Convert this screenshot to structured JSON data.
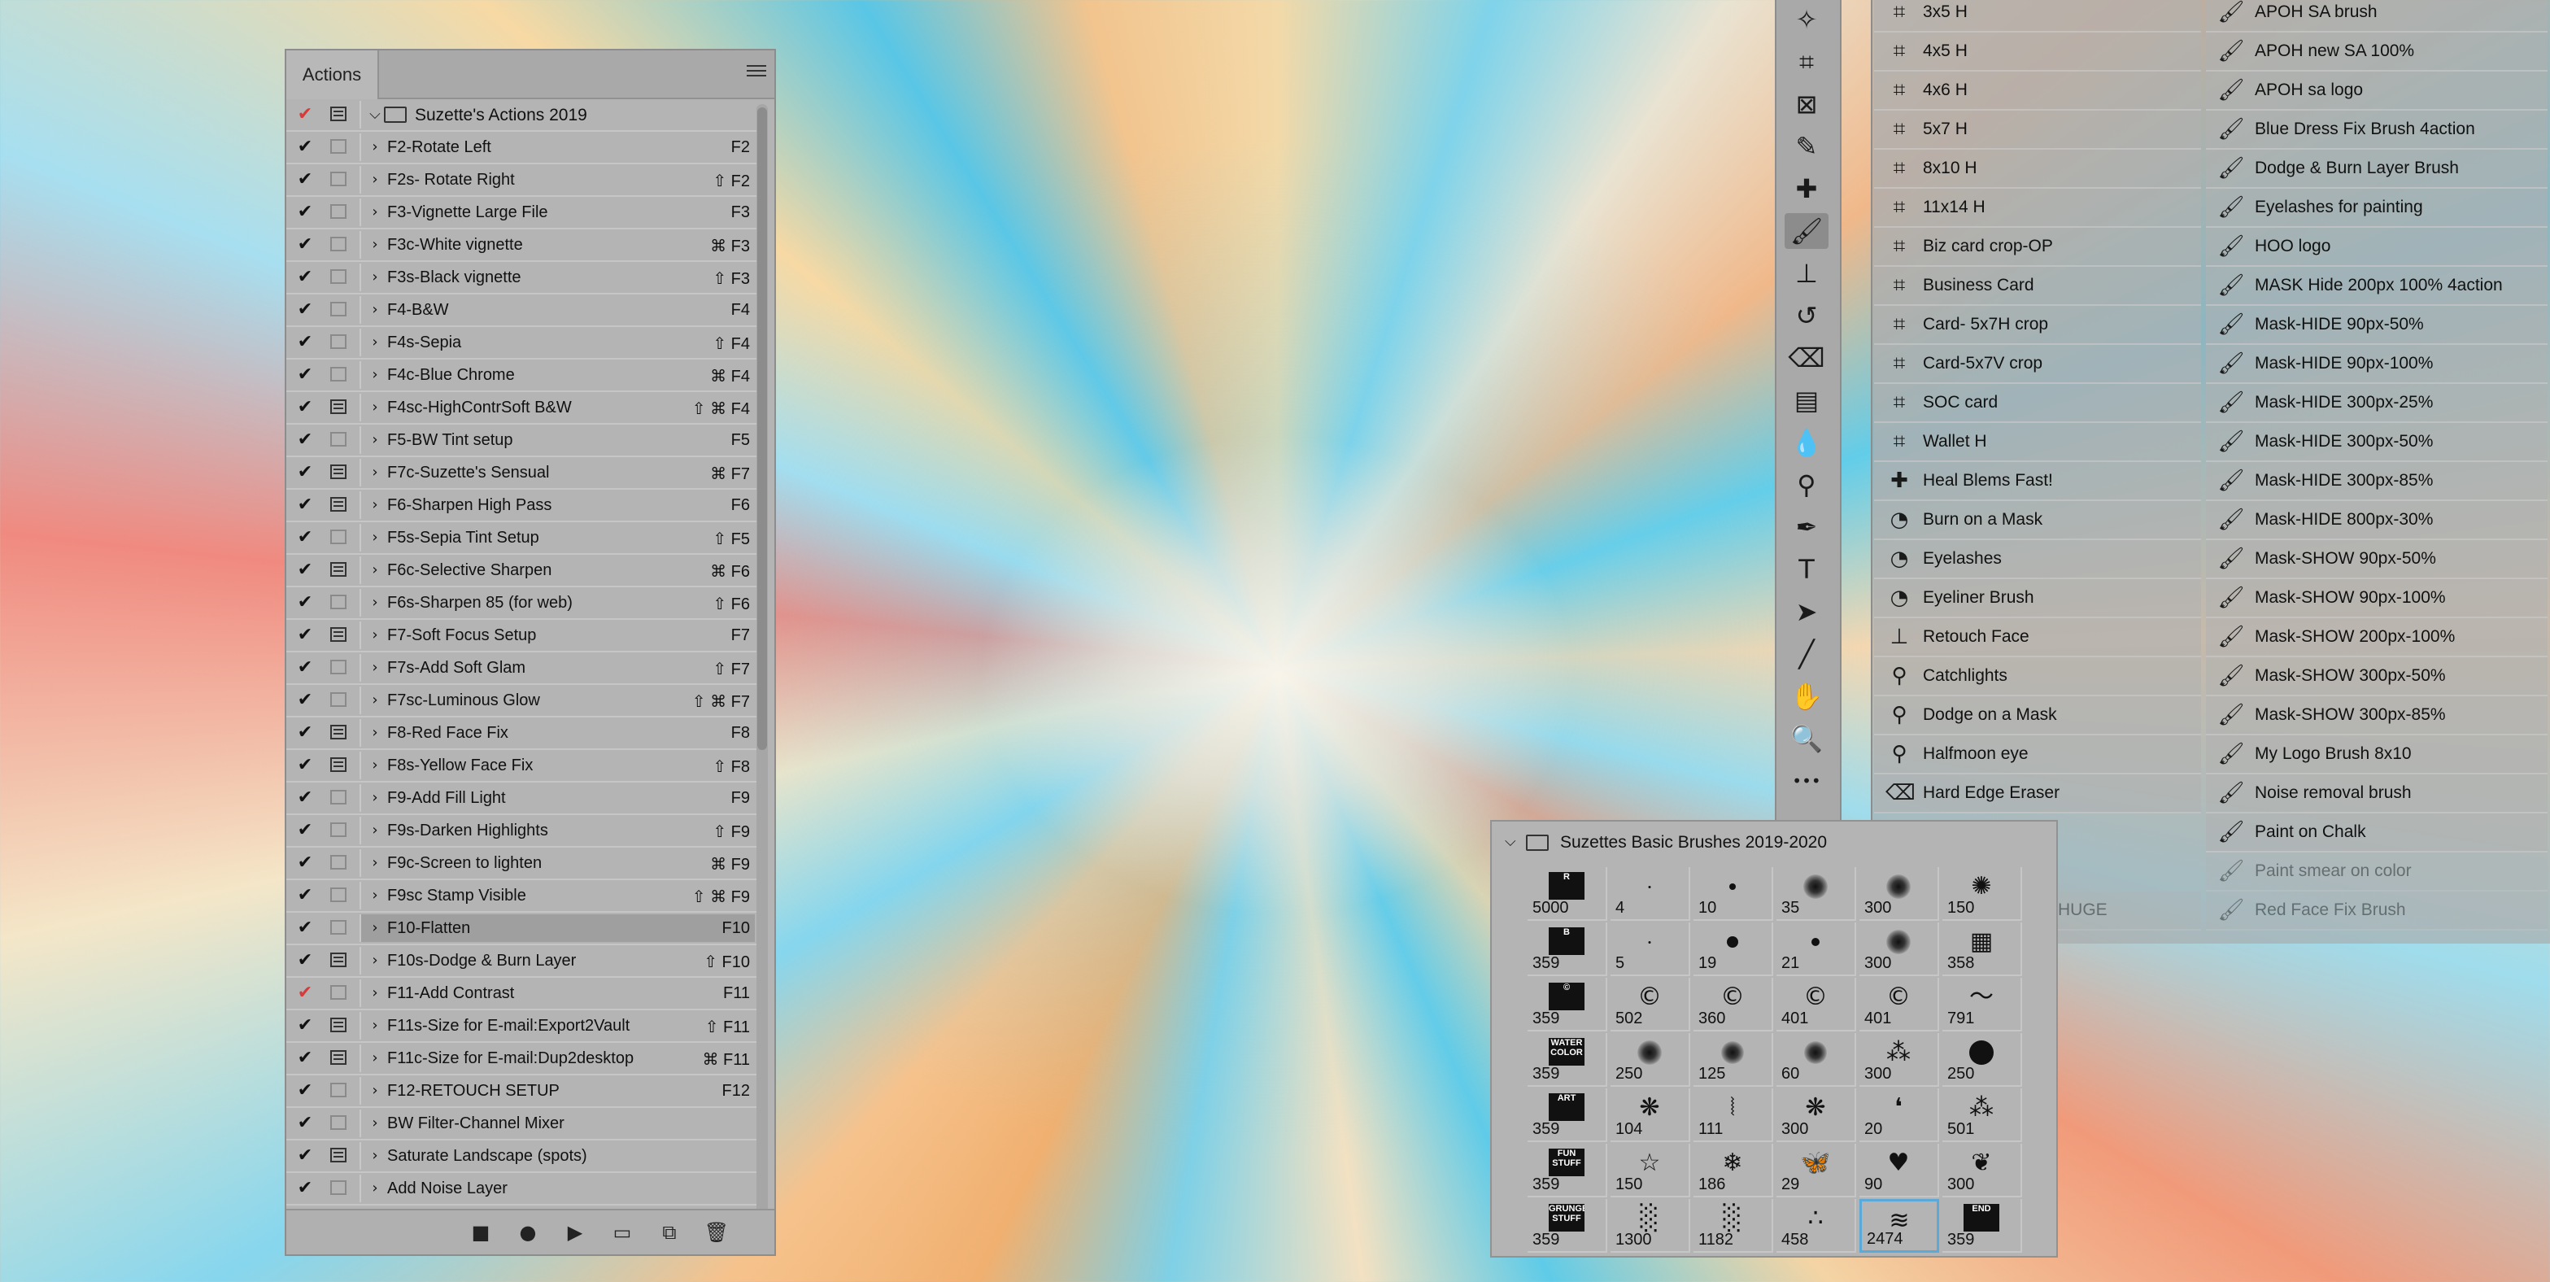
{
  "actions_panel": {
    "tab_label": "Actions",
    "set_name": "Suzette's Actions 2019",
    "actions": [
      {
        "check": "check",
        "dlg": false,
        "name": "F2-Rotate Left",
        "shortcut": "F2",
        "sel": false
      },
      {
        "check": "check",
        "dlg": false,
        "name": "F2s- Rotate Right",
        "shortcut": "⇧ F2",
        "sel": false
      },
      {
        "check": "check",
        "dlg": false,
        "name": "F3-Vignette Large File",
        "shortcut": "F3",
        "sel": false
      },
      {
        "check": "check",
        "dlg": false,
        "name": "F3c-White vignette",
        "shortcut": "⌘ F3",
        "sel": false
      },
      {
        "check": "check",
        "dlg": false,
        "name": "F3s-Black vignette",
        "shortcut": "⇧ F3",
        "sel": false
      },
      {
        "check": "check",
        "dlg": false,
        "name": "F4-B&W",
        "shortcut": "F4",
        "sel": false
      },
      {
        "check": "check",
        "dlg": false,
        "name": "F4s-Sepia",
        "shortcut": "⇧ F4",
        "sel": false
      },
      {
        "check": "check",
        "dlg": false,
        "name": "F4c-Blue Chrome",
        "shortcut": "⌘ F4",
        "sel": false
      },
      {
        "check": "check",
        "dlg": true,
        "name": "F4sc-HighContrSoft B&W",
        "shortcut": "⇧ ⌘ F4",
        "sel": false
      },
      {
        "check": "check",
        "dlg": false,
        "name": "F5-BW Tint setup",
        "shortcut": "F5",
        "sel": false
      },
      {
        "check": "check",
        "dlg": true,
        "name": "F7c-Suzette's Sensual",
        "shortcut": "⌘ F7",
        "sel": false
      },
      {
        "check": "check",
        "dlg": true,
        "name": "F6-Sharpen High Pass",
        "shortcut": "F6",
        "sel": false
      },
      {
        "check": "check",
        "dlg": false,
        "name": "F5s-Sepia Tint Setup",
        "shortcut": "⇧ F5",
        "sel": false
      },
      {
        "check": "check",
        "dlg": true,
        "name": "F6c-Selective Sharpen",
        "shortcut": "⌘ F6",
        "sel": false
      },
      {
        "check": "check",
        "dlg": false,
        "name": "F6s-Sharpen 85 (for web)",
        "shortcut": "⇧ F6",
        "sel": false
      },
      {
        "check": "check",
        "dlg": true,
        "name": "F7-Soft Focus Setup",
        "shortcut": "F7",
        "sel": false
      },
      {
        "check": "check",
        "dlg": false,
        "name": "F7s-Add Soft Glam",
        "shortcut": "⇧ F7",
        "sel": false
      },
      {
        "check": "check",
        "dlg": false,
        "name": "F7sc-Luminous Glow",
        "shortcut": "⇧ ⌘ F7",
        "sel": false
      },
      {
        "check": "check",
        "dlg": true,
        "name": "F8-Red Face Fix",
        "shortcut": "F8",
        "sel": false
      },
      {
        "check": "check",
        "dlg": true,
        "name": "F8s-Yellow Face Fix",
        "shortcut": "⇧ F8",
        "sel": false
      },
      {
        "check": "check",
        "dlg": false,
        "name": "F9-Add Fill Light",
        "shortcut": "F9",
        "sel": false
      },
      {
        "check": "check",
        "dlg": false,
        "name": "F9s-Darken Highlights",
        "shortcut": "⇧ F9",
        "sel": false
      },
      {
        "check": "check",
        "dlg": false,
        "name": "F9c-Screen to lighten",
        "shortcut": "⌘ F9",
        "sel": false
      },
      {
        "check": "check",
        "dlg": false,
        "name": "F9sc Stamp Visible",
        "shortcut": "⇧ ⌘ F9",
        "sel": false
      },
      {
        "check": "check",
        "dlg": false,
        "name": "F10-Flatten",
        "shortcut": "F10",
        "sel": true
      },
      {
        "check": "check",
        "dlg": true,
        "name": "F10s-Dodge & Burn Layer",
        "shortcut": "⇧ F10",
        "sel": false
      },
      {
        "check": "red",
        "dlg": false,
        "name": "F11-Add Contrast",
        "shortcut": "F11",
        "sel": false
      },
      {
        "check": "check",
        "dlg": true,
        "name": "F11s-Size for E-mail:Export2Vault",
        "shortcut": "⇧ F11",
        "sel": false
      },
      {
        "check": "check",
        "dlg": true,
        "name": "F11c-Size for E-mail:Dup2desktop",
        "shortcut": "⌘ F11",
        "sel": false
      },
      {
        "check": "check",
        "dlg": false,
        "name": "F12-RETOUCH SETUP",
        "shortcut": "F12",
        "sel": false
      },
      {
        "check": "check",
        "dlg": false,
        "name": "BW Filter-Channel Mixer",
        "shortcut": "",
        "sel": false
      },
      {
        "check": "check",
        "dlg": true,
        "name": "Saturate Landscape (spots)",
        "shortcut": "",
        "sel": false
      },
      {
        "check": "check",
        "dlg": false,
        "name": "Add Noise Layer",
        "shortcut": "",
        "sel": false
      }
    ],
    "footer_icons": [
      "stop-icon",
      "record-icon",
      "play-icon",
      "new-set-icon",
      "new-action-icon",
      "delete-icon"
    ]
  },
  "toolbar": {
    "tools": [
      {
        "name": "magic-wand-icon",
        "glyph": "✧"
      },
      {
        "name": "crop-icon",
        "glyph": "⌗"
      },
      {
        "name": "frame-icon",
        "glyph": "⊠"
      },
      {
        "name": "eyedropper-icon",
        "glyph": "✎"
      },
      {
        "name": "healing-brush-icon",
        "glyph": "✚"
      },
      {
        "name": "brush-icon",
        "glyph": "🖌",
        "active": true
      },
      {
        "name": "clone-stamp-icon",
        "glyph": "⊥"
      },
      {
        "name": "history-brush-icon",
        "glyph": "↺"
      },
      {
        "name": "eraser-icon",
        "glyph": "⌫"
      },
      {
        "name": "gradient-icon",
        "glyph": "▤"
      },
      {
        "name": "blur-icon",
        "glyph": "💧"
      },
      {
        "name": "dodge-icon",
        "glyph": "⚲"
      },
      {
        "name": "pen-icon",
        "glyph": "✒"
      },
      {
        "name": "type-icon",
        "glyph": "T"
      },
      {
        "name": "path-selection-icon",
        "glyph": "➤"
      },
      {
        "name": "line-icon",
        "glyph": "╱"
      },
      {
        "name": "hand-icon",
        "glyph": "✋"
      },
      {
        "name": "zoom-icon",
        "glyph": "🔍"
      },
      {
        "name": "more-tools-icon",
        "glyph": "•••"
      }
    ]
  },
  "presets_panel": {
    "left": [
      {
        "icon": "crop-icon",
        "g": "⌗",
        "label": "3x5 H"
      },
      {
        "icon": "crop-icon",
        "g": "⌗",
        "label": "4x5 H"
      },
      {
        "icon": "crop-icon",
        "g": "⌗",
        "label": "4x6 H"
      },
      {
        "icon": "crop-icon",
        "g": "⌗",
        "label": "5x7 H"
      },
      {
        "icon": "crop-icon",
        "g": "⌗",
        "label": "8x10 H"
      },
      {
        "icon": "crop-icon",
        "g": "⌗",
        "label": "11x14 H"
      },
      {
        "icon": "crop-icon",
        "g": "⌗",
        "label": "Biz card crop-OP"
      },
      {
        "icon": "crop-icon",
        "g": "⌗",
        "label": "Business Card"
      },
      {
        "icon": "crop-icon",
        "g": "⌗",
        "label": "Card- 5x7H crop"
      },
      {
        "icon": "crop-icon",
        "g": "⌗",
        "label": "Card-5x7V crop"
      },
      {
        "icon": "crop-icon",
        "g": "⌗",
        "label": "SOC card"
      },
      {
        "icon": "crop-icon",
        "g": "⌗",
        "label": "Wallet H"
      },
      {
        "icon": "healing-brush-icon",
        "g": "✚",
        "label": "Heal Blems Fast!"
      },
      {
        "icon": "burn-icon",
        "g": "◔",
        "label": "Burn on a Mask"
      },
      {
        "icon": "burn-icon",
        "g": "◔",
        "label": "Eyelashes"
      },
      {
        "icon": "burn-icon",
        "g": "◔",
        "label": "Eyeliner Brush"
      },
      {
        "icon": "clone-stamp-icon",
        "g": "⊥",
        "label": "Retouch Face"
      },
      {
        "icon": "dodge-icon",
        "g": "⚲",
        "label": "Catchlights"
      },
      {
        "icon": "dodge-icon",
        "g": "⚲",
        "label": "Dodge on a Mask"
      },
      {
        "icon": "dodge-icon",
        "g": "⚲",
        "label": "Halfmoon eye"
      },
      {
        "icon": "eraser-icon",
        "g": "⌫",
        "label": "Hard Edge Eraser"
      }
    ],
    "right": [
      "APOH SA brush",
      "APOH new SA 100%",
      "APOH sa logo",
      "Blue Dress Fix Brush 4action",
      "Dodge & Burn Layer Brush",
      "Eyelashes for painting",
      "HOO logo",
      "MASK Hide 200px 100% 4action",
      "Mask-HIDE 90px-50%",
      "Mask-HIDE 90px-100%",
      "Mask-HIDE 300px-25%",
      "Mask-HIDE 300px-50%",
      "Mask-HIDE 300px-85%",
      "Mask-HIDE 800px-30%",
      "Mask-SHOW 90px-50%",
      "Mask-SHOW 90px-100%",
      "Mask-SHOW 200px-100%",
      "Mask-SHOW 300px-50%",
      "Mask-SHOW 300px-85%",
      "My Logo Brush 8x10",
      "Noise removal brush",
      "Paint on Chalk",
      "Paint smear on color",
      "Red Face Fix Brush"
    ],
    "partial_left_label": "HUGE"
  },
  "brush_panel": {
    "group_name": "Suzettes Basic Brushes 2019-2020",
    "rows": [
      [
        {
          "t": "box",
          "txt": "R",
          "n": "5000"
        },
        {
          "t": "dot",
          "s": 3,
          "n": "4"
        },
        {
          "t": "dot",
          "s": 8,
          "n": "10"
        },
        {
          "t": "soft",
          "s": 30,
          "n": "35"
        },
        {
          "t": "soft",
          "s": 30,
          "n": "300"
        },
        {
          "t": "glyph",
          "g": "✺",
          "n": "150"
        }
      ],
      [
        {
          "t": "box",
          "txt": "B",
          "n": "359"
        },
        {
          "t": "dot",
          "s": 3,
          "n": "5"
        },
        {
          "t": "dot",
          "s": 14,
          "n": "19"
        },
        {
          "t": "dot",
          "s": 10,
          "n": "21"
        },
        {
          "t": "soft",
          "s": 30,
          "n": "300"
        },
        {
          "t": "glyph",
          "g": "▦",
          "n": "358"
        }
      ],
      [
        {
          "t": "box",
          "txt": "©",
          "n": "359"
        },
        {
          "t": "glyph",
          "g": "©",
          "n": "502"
        },
        {
          "t": "glyph",
          "g": "©",
          "n": "360"
        },
        {
          "t": "glyph",
          "g": "©",
          "n": "401"
        },
        {
          "t": "glyph",
          "g": "©",
          "n": "401"
        },
        {
          "t": "glyph",
          "g": "～",
          "n": "791"
        }
      ],
      [
        {
          "t": "box",
          "txt": "WATER COLOR",
          "n": "359"
        },
        {
          "t": "soft",
          "s": 30,
          "n": "250"
        },
        {
          "t": "soft",
          "s": 28,
          "n": "125"
        },
        {
          "t": "soft",
          "s": 28,
          "n": "60"
        },
        {
          "t": "glyph",
          "g": "⁂",
          "n": "300"
        },
        {
          "t": "dot",
          "s": 30,
          "n": "250"
        }
      ],
      [
        {
          "t": "box",
          "txt": "ART",
          "n": "359"
        },
        {
          "t": "glyph",
          "g": "❋",
          "n": "104"
        },
        {
          "t": "glyph",
          "g": "⦚",
          "n": "111"
        },
        {
          "t": "glyph",
          "g": "❋",
          "n": "300"
        },
        {
          "t": "glyph",
          "g": "❛",
          "n": "20"
        },
        {
          "t": "glyph",
          "g": "⁂",
          "n": "501"
        }
      ],
      [
        {
          "t": "box",
          "txt": "FUN STUFF",
          "n": "359"
        },
        {
          "t": "glyph",
          "g": "☆",
          "n": "150"
        },
        {
          "t": "glyph",
          "g": "❄",
          "n": "186"
        },
        {
          "t": "glyph",
          "g": "🦋",
          "n": "29"
        },
        {
          "t": "glyph",
          "g": "♥",
          "n": "90"
        },
        {
          "t": "glyph",
          "g": "❦",
          "n": "300"
        }
      ],
      [
        {
          "t": "box",
          "txt": "GRUNGE STUFF",
          "n": "359"
        },
        {
          "t": "glyph",
          "g": "░",
          "n": "1300"
        },
        {
          "t": "glyph",
          "g": "░",
          "n": "1182"
        },
        {
          "t": "glyph",
          "g": "∴",
          "n": "458"
        },
        {
          "t": "glyph",
          "g": "≋",
          "n": "2474",
          "sel": true
        },
        {
          "t": "box",
          "txt": "END",
          "n": "359"
        }
      ]
    ]
  }
}
